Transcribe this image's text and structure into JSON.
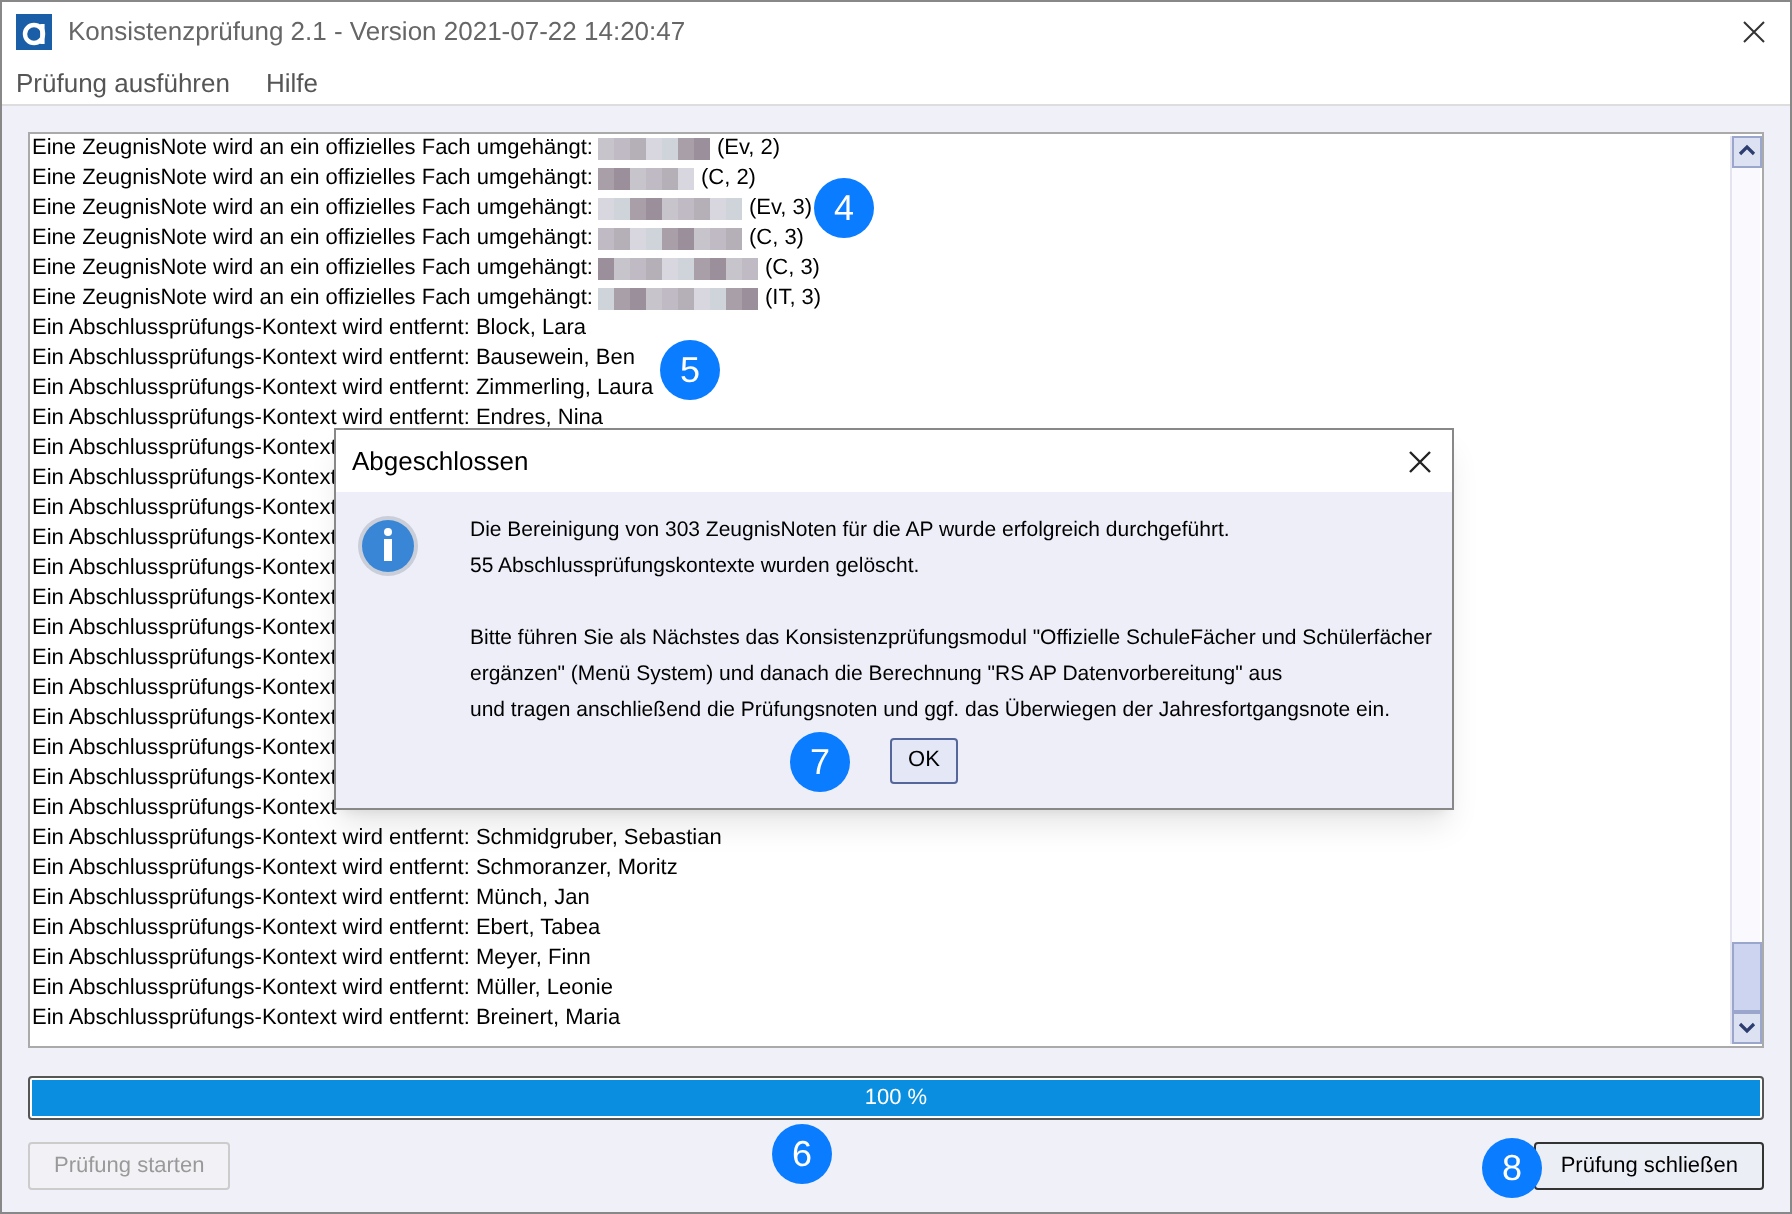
{
  "window": {
    "title": "Konsistenzprüfung 2.1 - Version 2021-07-22 14:20:47"
  },
  "menu": [
    "Prüfung ausführen",
    "Hilfe"
  ],
  "log": [
    {
      "kind": "grade",
      "text": "Eine ZeugnisNote wird an ein offizielles Fach umgehängt:",
      "detail": "(Ev, 2)"
    },
    {
      "kind": "grade",
      "text": "Eine ZeugnisNote wird an ein offizielles Fach umgehängt:",
      "detail": "(C, 2)"
    },
    {
      "kind": "grade",
      "text": "Eine ZeugnisNote wird an ein offizielles Fach umgehängt:",
      "detail": "(Ev, 3)"
    },
    {
      "kind": "grade",
      "text": "Eine ZeugnisNote wird an ein offizielles Fach umgehängt:",
      "detail": "(C, 3)"
    },
    {
      "kind": "grade",
      "text": "Eine ZeugnisNote wird an ein offizielles Fach umgehängt:",
      "detail": "(C, 3)"
    },
    {
      "kind": "grade",
      "text": "Eine ZeugnisNote wird an ein offizielles Fach umgehängt:",
      "detail": "(IT, 3)"
    },
    {
      "kind": "context",
      "text": "Ein Abschlussprüfungs-Kontext wird entfernt: Block, Lara"
    },
    {
      "kind": "context",
      "text": "Ein Abschlussprüfungs-Kontext wird entfernt: Bausewein, Ben"
    },
    {
      "kind": "context",
      "text": "Ein Abschlussprüfungs-Kontext wird entfernt: Zimmerling, Laura"
    },
    {
      "kind": "context",
      "text": "Ein Abschlussprüfungs-Kontext wird entfernt: Endres, Nina"
    },
    {
      "kind": "context",
      "text": "Ein Abschlussprüfungs-Kontext"
    },
    {
      "kind": "context",
      "text": "Ein Abschlussprüfungs-Kontext"
    },
    {
      "kind": "context",
      "text": "Ein Abschlussprüfungs-Kontext"
    },
    {
      "kind": "context",
      "text": "Ein Abschlussprüfungs-Kontext"
    },
    {
      "kind": "context",
      "text": "Ein Abschlussprüfungs-Kontext"
    },
    {
      "kind": "context",
      "text": "Ein Abschlussprüfungs-Kontext"
    },
    {
      "kind": "context",
      "text": "Ein Abschlussprüfungs-Kontext"
    },
    {
      "kind": "context",
      "text": "Ein Abschlussprüfungs-Kontext"
    },
    {
      "kind": "context",
      "text": "Ein Abschlussprüfungs-Kontext"
    },
    {
      "kind": "context",
      "text": "Ein Abschlussprüfungs-Kontext"
    },
    {
      "kind": "context",
      "text": "Ein Abschlussprüfungs-Kontext"
    },
    {
      "kind": "context",
      "text": "Ein Abschlussprüfungs-Kontext"
    },
    {
      "kind": "context",
      "text": "Ein Abschlussprüfungs-Kontext"
    },
    {
      "kind": "context",
      "text": "Ein Abschlussprüfungs-Kontext wird entfernt: Schmidgruber, Sebastian"
    },
    {
      "kind": "context",
      "text": "Ein Abschlussprüfungs-Kontext wird entfernt: Schmoranzer, Moritz"
    },
    {
      "kind": "context",
      "text": "Ein Abschlussprüfungs-Kontext wird entfernt: Münch, Jan"
    },
    {
      "kind": "context",
      "text": "Ein Abschlussprüfungs-Kontext wird entfernt: Ebert, Tabea"
    },
    {
      "kind": "context",
      "text": "Ein Abschlussprüfungs-Kontext wird entfernt: Meyer, Finn"
    },
    {
      "kind": "context",
      "text": "Ein Abschlussprüfungs-Kontext wird entfernt: Müller, Leonie"
    },
    {
      "kind": "context",
      "text": "Ein Abschlussprüfungs-Kontext wird entfernt: Breinert, Maria"
    }
  ],
  "progress": {
    "level": 1,
    "label": "100 %"
  },
  "buttons": [
    {
      "label": "Prüfung starten",
      "disabled": true
    },
    {
      "label": "Prüfung schließen",
      "disabled": false
    }
  ],
  "dialog": {
    "title": "Abgeschlossen",
    "paragraphs": [
      [
        "Die Bereinigung von 303 ZeugnisNoten für die AP wurde erfolgreich durchgeführt.",
        "55 Abschlussprüfungskontexte wurden gelöscht."
      ],
      [
        "Bitte führen Sie als Nächstes das Konsistenzprüfungsmodul \"Offizielle SchuleFächer und Schülerfächer",
        "ergänzen\" (Menü System) und danach die Berechnung \"RS AP Datenvorbereitung\" aus",
        "und tragen anschließend die Prüfungsnoten und ggf. das Überwiegen der Jahresfortgangsnote ein."
      ]
    ],
    "button": "OK"
  },
  "callouts": [
    "4",
    "5",
    "6",
    "7",
    "8"
  ]
}
